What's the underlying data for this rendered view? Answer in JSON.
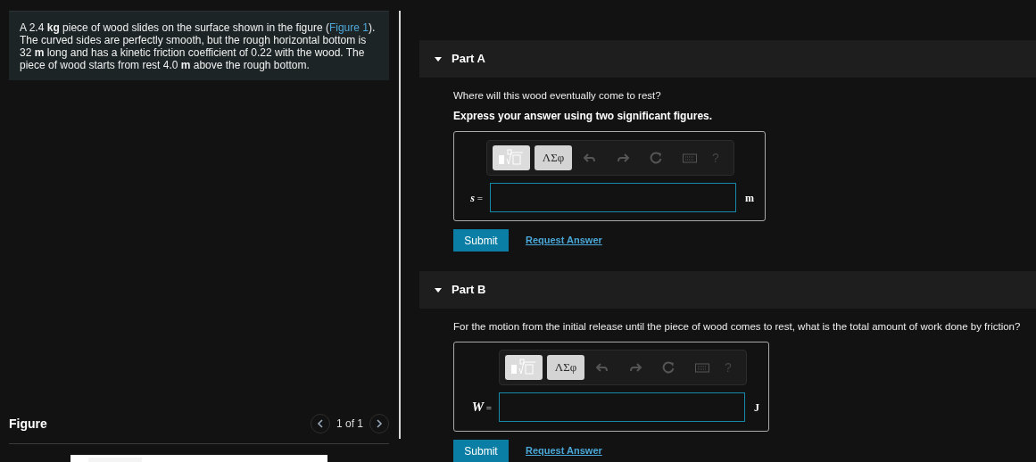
{
  "problem": {
    "before": "A 2.4 **kg** piece of wood slides on the surface shown in the figure (",
    "link": "Figure 1",
    "after": "). The curved sides are perfectly smooth, but the rough horizontal bottom is 32 **m** long and has a kinetic friction coefficient of 0.22 with the wood. The piece of wood starts from rest 4.0 **m** above the rough bottom."
  },
  "figure": {
    "title": "Figure",
    "pager": "1 of 1"
  },
  "parts": [
    {
      "title": "Part A",
      "expanded": true,
      "question": "Where will this wood eventually come to rest?",
      "instruction": "Express your answer using two significant figures.",
      "variable": "s",
      "equals": "=",
      "unit": "m",
      "greek": "ΛΣφ",
      "help": "?",
      "submit": "Submit",
      "request": "Request Answer"
    },
    {
      "title": "Part B",
      "expanded": true,
      "question": "For the motion from the initial release until the piece of wood comes to rest, what is the total amount of work done by friction?",
      "variable": "W",
      "equals": "=",
      "unit": "J",
      "greek": "ΛΣφ",
      "help": "?",
      "submit": "Submit",
      "request": "Request Answer"
    }
  ]
}
